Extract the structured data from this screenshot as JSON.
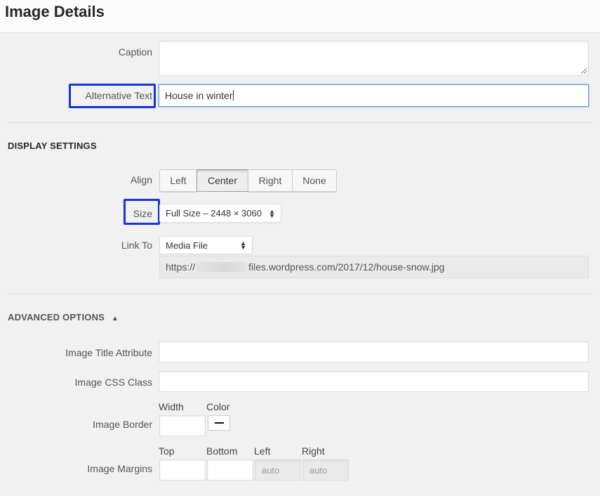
{
  "header": {
    "title": "Image Details"
  },
  "caption": {
    "label": "Caption",
    "value": ""
  },
  "alt_text": {
    "label": "Alternative Text",
    "value": "House in winter"
  },
  "display_settings": {
    "title": "DISPLAY SETTINGS",
    "align": {
      "label": "Align",
      "options": [
        "Left",
        "Center",
        "Right",
        "None"
      ],
      "selected": "Center"
    },
    "size": {
      "label": "Size",
      "value": "Full Size – 2448 × 3060"
    },
    "link_to": {
      "label": "Link To",
      "value": "Media File",
      "url_prefix": "https://",
      "url_suffix": "files.wordpress.com/2017/12/house-snow.jpg"
    }
  },
  "advanced_options": {
    "title": "ADVANCED OPTIONS",
    "toggle_icon": "triangle-up",
    "title_attribute": {
      "label": "Image Title Attribute",
      "value": ""
    },
    "css_class": {
      "label": "Image CSS Class",
      "value": ""
    },
    "border": {
      "label": "Image Border",
      "width_label": "Width",
      "color_label": "Color",
      "width_value": ""
    },
    "margins": {
      "label": "Image Margins",
      "top_label": "Top",
      "bottom_label": "Bottom",
      "left_label": "Left",
      "right_label": "Right",
      "top_value": "",
      "bottom_value": "",
      "left_value": "auto",
      "right_value": "auto"
    }
  },
  "colors": {
    "highlight": "#1534e0",
    "focus_border": "#5b9dd9",
    "background": "#f1f1f1"
  }
}
